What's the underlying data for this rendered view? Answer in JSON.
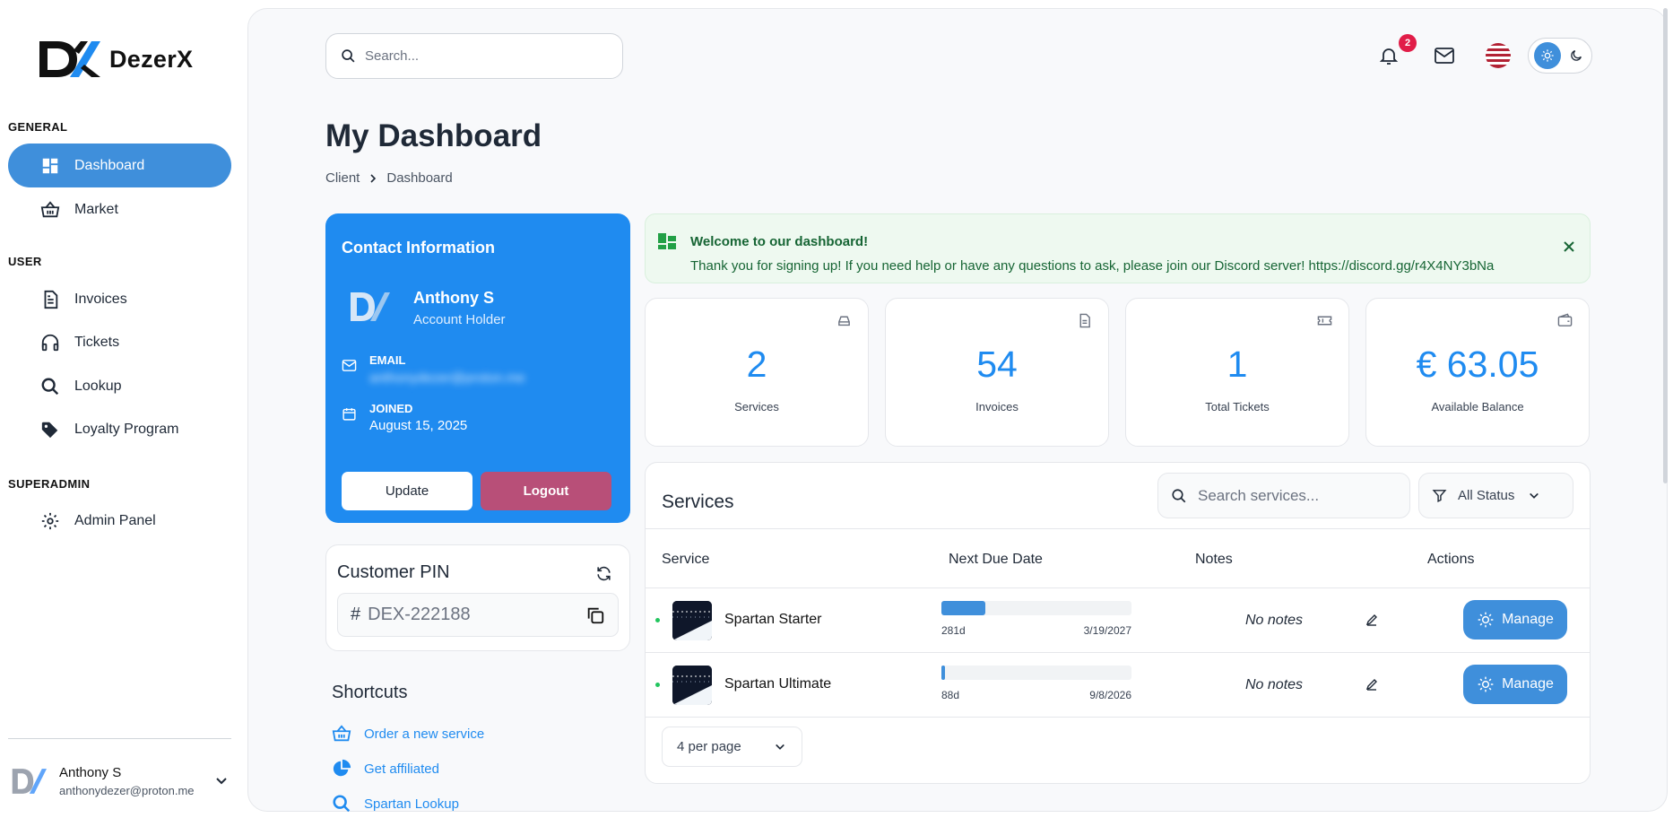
{
  "app": {
    "name": "DezerX"
  },
  "sidebar": {
    "sections": [
      {
        "label": "GENERAL"
      },
      {
        "label": "USER"
      },
      {
        "label": "SUPERADMIN"
      }
    ],
    "items": [
      {
        "label": "Dashboard",
        "icon": "dashboard-icon",
        "active": true
      },
      {
        "label": "Market",
        "icon": "basket-icon"
      },
      {
        "label": "Invoices",
        "icon": "document-icon"
      },
      {
        "label": "Tickets",
        "icon": "headphones-icon"
      },
      {
        "label": "Lookup",
        "icon": "search-icon"
      },
      {
        "label": "Loyalty Program",
        "icon": "tag-icon"
      },
      {
        "label": "Admin Panel",
        "icon": "gear-icon"
      }
    ],
    "user": {
      "name": "Anthony S",
      "email": "anthonydezer@proton.me"
    }
  },
  "header": {
    "search_placeholder": "Search...",
    "notification_count": "2"
  },
  "page": {
    "title": "My Dashboard",
    "breadcrumb": [
      "Client",
      "Dashboard"
    ]
  },
  "contact": {
    "title": "Contact Information",
    "name": "Anthony S",
    "role": "Account Holder",
    "email_label": "EMAIL",
    "email_value": "anthonydezer@proton.me",
    "joined_label": "JOINED",
    "joined_value": "August 15, 2025",
    "update_label": "Update",
    "logout_label": "Logout"
  },
  "pin": {
    "title": "Customer PIN",
    "hash": "#",
    "value": "DEX-222188"
  },
  "shortcuts": {
    "title": "Shortcuts",
    "items": [
      {
        "label": "Order a new service",
        "icon": "basket-icon"
      },
      {
        "label": "Get affiliated",
        "icon": "pie-chart-icon"
      },
      {
        "label": "Spartan Lookup",
        "icon": "search-icon"
      }
    ]
  },
  "alert": {
    "title": "Welcome to our dashboard!",
    "body": "Thank you for signing up! If you need help or have any questions to ask, please join our Discord server! https://discord.gg/r4X4NY3bNa"
  },
  "stats": [
    {
      "value": "2",
      "label": "Services",
      "icon": "server-icon"
    },
    {
      "value": "54",
      "label": "Invoices",
      "icon": "document-icon"
    },
    {
      "value": "1",
      "label": "Total Tickets",
      "icon": "ticket-icon"
    },
    {
      "value": "€ 63.05",
      "label": "Available Balance",
      "icon": "wallet-icon"
    }
  ],
  "services": {
    "title": "Services",
    "search_placeholder": "Search services...",
    "filter_label": "All Status",
    "columns": [
      "Service",
      "Next Due Date",
      "Notes",
      "Actions"
    ],
    "rows": [
      {
        "name": "Spartan Starter",
        "days_left": "281d",
        "due_date": "3/19/2027",
        "progress": 0.23,
        "notes": "No notes",
        "action": "Manage"
      },
      {
        "name": "Spartan Ultimate",
        "days_left": "88d",
        "due_date": "9/8/2026",
        "progress": 0.02,
        "notes": "No notes",
        "action": "Manage"
      }
    ],
    "per_page": "4 per page"
  },
  "colors": {
    "accent": "#3f8fdb",
    "contact_bg": "#1f8bf0",
    "logout": "#b84f78",
    "alert_bg": "#eef9f0",
    "badge": "#e11d48"
  }
}
